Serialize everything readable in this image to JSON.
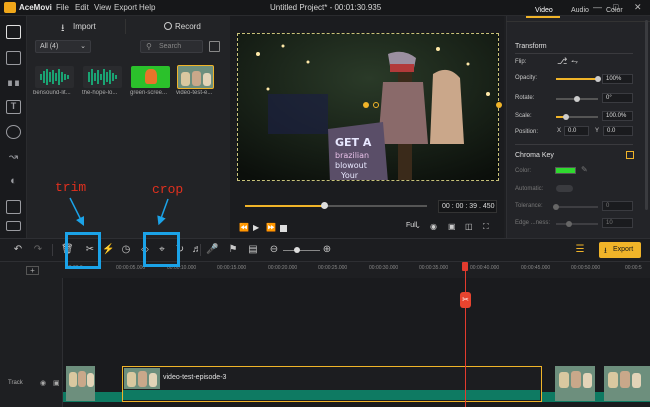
{
  "app": {
    "name": "AceMovi",
    "window_title": "Untitled Project* - 00:01:30.935"
  },
  "menu": [
    "File",
    "Edit",
    "View",
    "Export",
    "Help"
  ],
  "media": {
    "import_label": "Import",
    "record_label": "Record",
    "filter_value": "All (4)",
    "search_placeholder": "Search",
    "items": [
      {
        "label": "bensound-lit..."
      },
      {
        "label": "the-hope-lo..."
      },
      {
        "label": "green-scree..."
      },
      {
        "label": "video-test-e..."
      }
    ]
  },
  "preview": {
    "timecode": "00 : 00 : 39 . 450",
    "quality": "Full"
  },
  "inspector": {
    "tabs": [
      "Video",
      "Audio",
      "Color"
    ],
    "transform_title": "Transform",
    "flip_label": "Flip:",
    "opacity_label": "Opacity:",
    "opacity_value": "100%",
    "opacity_fraction": 1.0,
    "rotate_label": "Rotate:",
    "rotate_value": "0°",
    "scale_label": "Scale:",
    "scale_value": "100.0%",
    "position_label": "Position:",
    "pos_x_label": "X",
    "pos_x": "0.0",
    "pos_y_label": "Y",
    "pos_y": "0.0",
    "chroma_title": "Chroma Key",
    "color_label": "Color:",
    "automatic_label": "Automatic:",
    "tolerance_label": "Tolerance:",
    "tolerance_value": "0",
    "edge_label": "Edge ...ness:",
    "edge_value": "10"
  },
  "toolbar": {
    "export_label": "Export"
  },
  "ruler": {
    "ticks": [
      "00:00:0",
      "00:00:05.000",
      "00:00:10.000",
      "00:00:15.000",
      "00:00:20.000",
      "00:00:25.000",
      "00:00:30.000",
      "00:00:35.000",
      "00:00:40.000",
      "00:00:45.000",
      "00:00:50.000",
      "00:00:5"
    ]
  },
  "timeline": {
    "track_label": "Track",
    "clip_label": "video-test-episode-3"
  },
  "annotations": {
    "trim": "trim",
    "crop": "crop"
  },
  "colors": {
    "accent": "#f0b429",
    "playhead": "#e33b2e",
    "annotation_box": "#1ba3e8",
    "chroma_color": "#2fd92f"
  }
}
